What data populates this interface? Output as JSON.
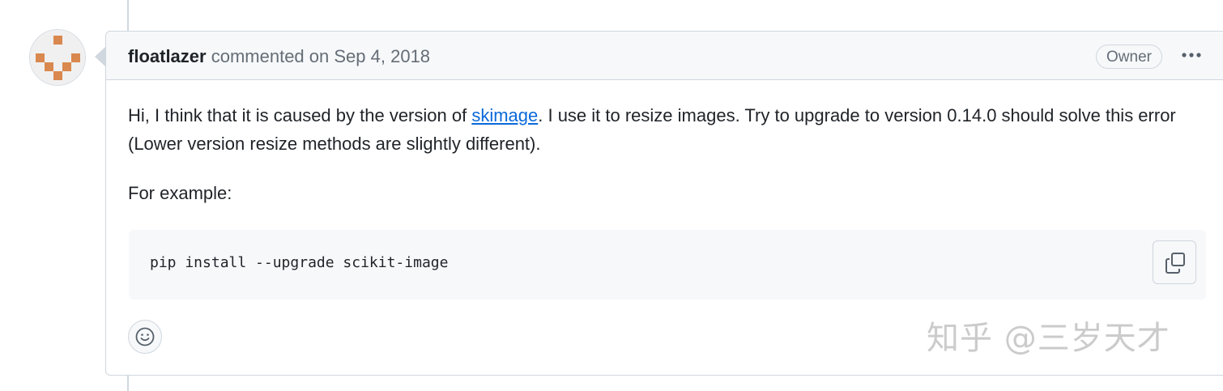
{
  "comment": {
    "author": "floatlazer",
    "action": "commented on",
    "date": "Sep 4, 2018",
    "badge": "Owner",
    "more_icon": "kebab-horizontal-icon",
    "body": {
      "para1_before_link": "Hi, I think that it is caused by the version of ",
      "link_text": "skimage",
      "para1_after_link": ". I use it to resize images. Try to upgrade to version 0.14.0 should solve this error (Lower version resize methods are slightly different).",
      "para2": "For example:"
    },
    "code": "pip install --upgrade scikit-image",
    "copy_icon": "copy-icon",
    "reaction_icon": "smiley-icon"
  },
  "watermark": "知乎 @三岁天才",
  "colors": {
    "link": "#0969da",
    "border": "#d0d7de",
    "header_bg": "#f6f8fa",
    "avatar_accent": "#d9884f"
  }
}
